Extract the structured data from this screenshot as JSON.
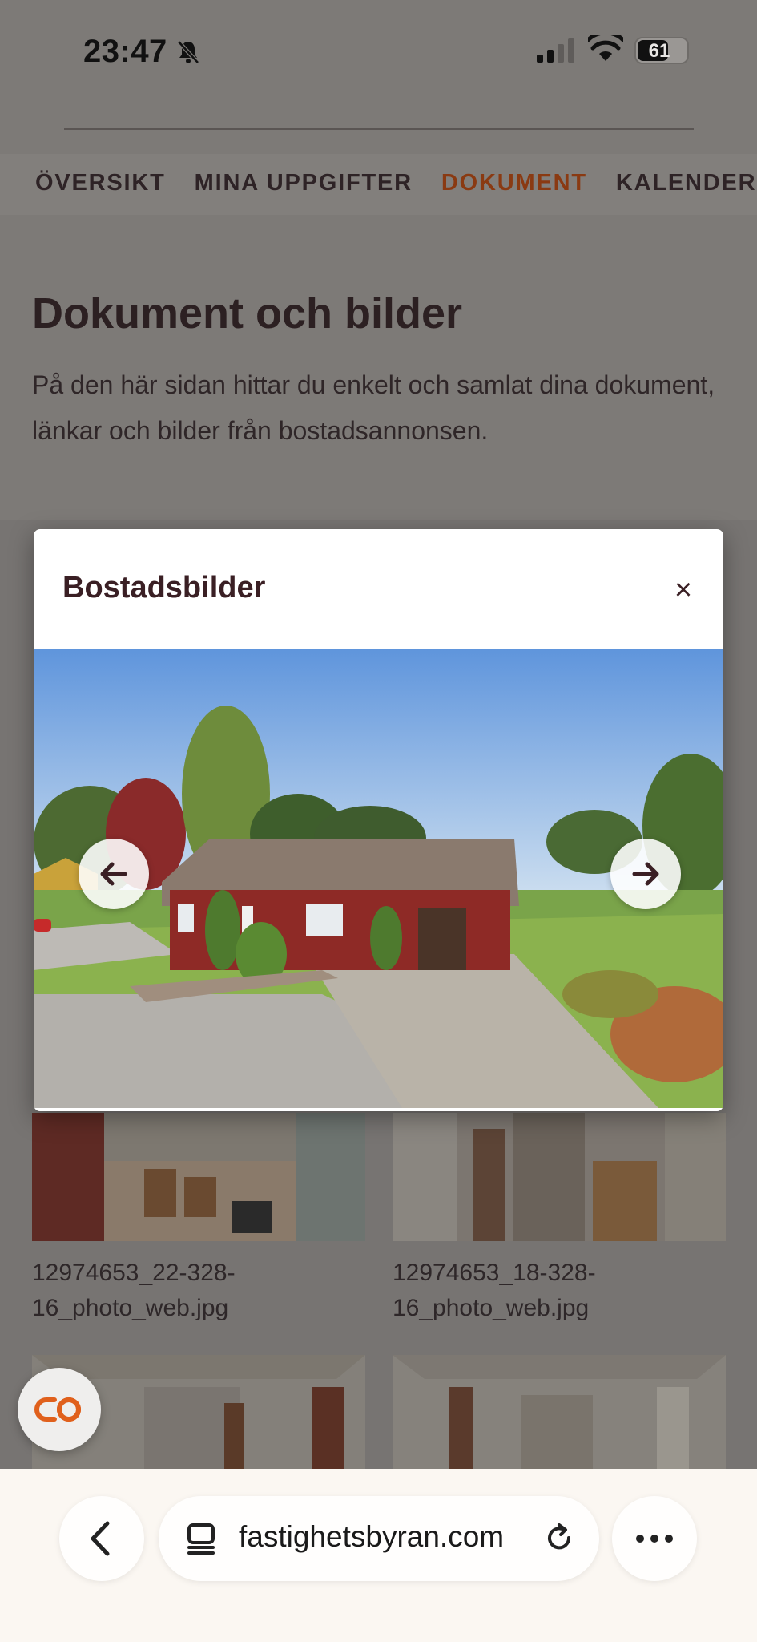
{
  "status_bar": {
    "time": "23:47",
    "battery": "61",
    "icons": [
      "bell-muted-icon",
      "signal-icon",
      "wifi-icon",
      "battery-icon"
    ]
  },
  "nav": {
    "tabs": [
      {
        "label": "ÖVERSIKT",
        "active": false
      },
      {
        "label": "MINA UPPGIFTER",
        "active": false
      },
      {
        "label": "DOKUMENT",
        "active": true
      },
      {
        "label": "KALENDER",
        "active": false
      }
    ],
    "accent_color": "#c1501a"
  },
  "page": {
    "title": "Dokument och bilder",
    "intro": "På den här sidan hittar du enkelt och samlat dina dokument, länkar och bilder från bostadsannonsen."
  },
  "gallery": {
    "items": [
      {
        "caption": "12974653_22-328-16_photo_web.jpg"
      },
      {
        "caption": "12974653_18-328-16_photo_web.jpg"
      },
      {
        "caption": ""
      },
      {
        "caption": ""
      }
    ]
  },
  "modal": {
    "title": "Bostadsbilder",
    "close_label": "×",
    "prev_icon": "arrow-left-icon",
    "next_icon": "arrow-right-icon"
  },
  "fab": {
    "icon": "chat-logo-icon",
    "color": "#e0601c"
  },
  "browser": {
    "url": "fastighetsbyran.com",
    "icons": [
      "back-icon",
      "page-icon",
      "reload-icon",
      "more-icon"
    ]
  }
}
